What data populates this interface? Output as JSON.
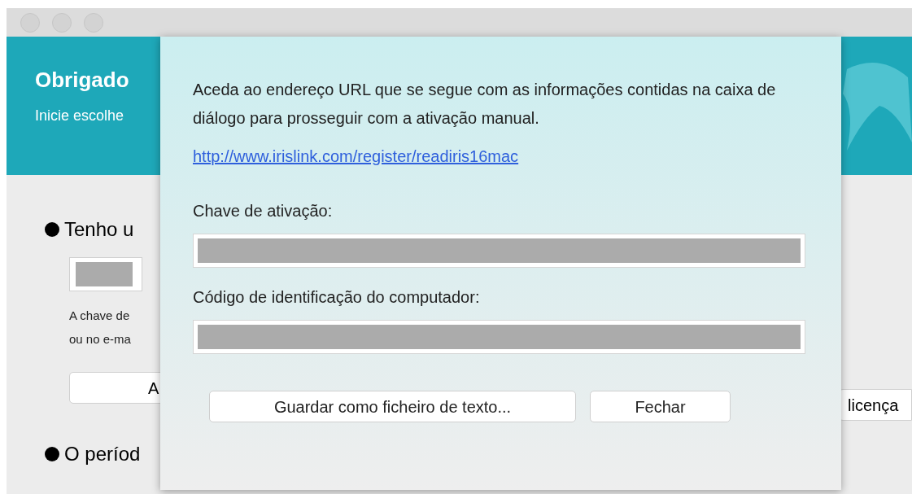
{
  "window": {
    "header": {
      "title": "Obrigado",
      "subtitle": "Inicie escolhe"
    },
    "options": [
      {
        "label": "Tenho u",
        "selected": true,
        "hint_lines": [
          "A chave de",
          "ou no e-ma"
        ],
        "button": "A"
      },
      {
        "label": "O períod",
        "selected": true
      }
    ],
    "right_button": "licença"
  },
  "dialog": {
    "message": "Aceda ao endereço URL que se segue com as informações contidas na caixa de diálogo para prosseguir com a ativação manual.",
    "link": "http://www.irislink.com/register/readiris16mac",
    "fields": [
      {
        "label": "Chave de ativação:"
      },
      {
        "label": "Código de identificação do computador:"
      }
    ],
    "buttons": [
      "Guardar como ficheiro de texto...",
      "Fechar"
    ]
  }
}
